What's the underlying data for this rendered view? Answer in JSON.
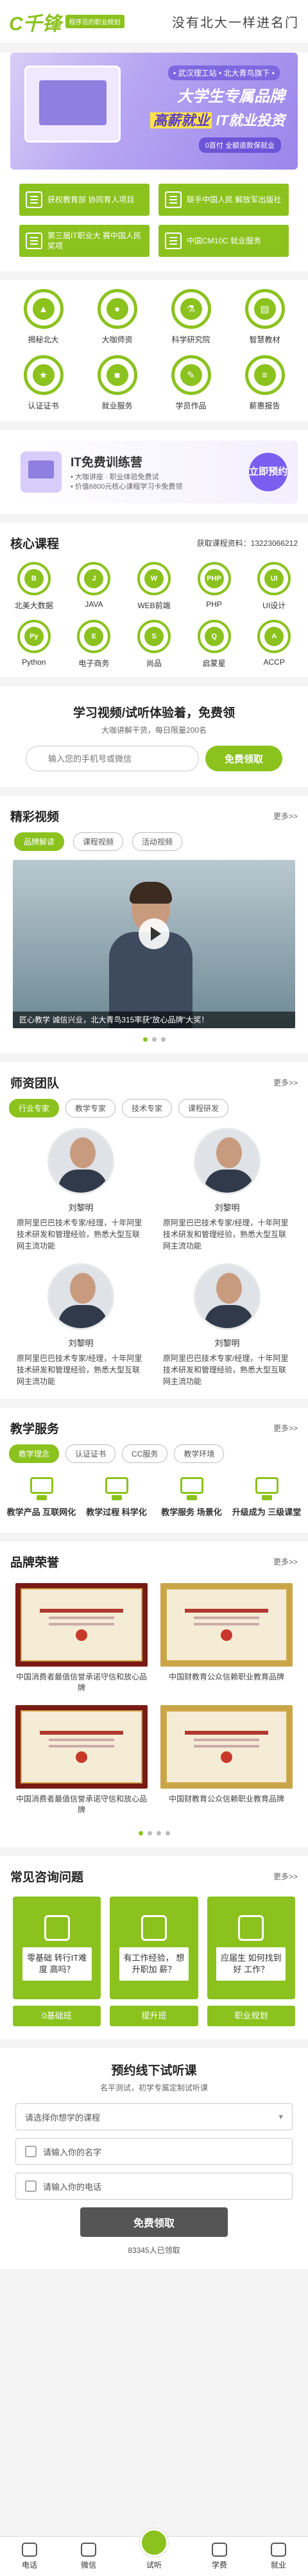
{
  "header": {
    "logo": "C千锋",
    "tag": "程序员的职业规划",
    "slogan": "没有北大一样进名门"
  },
  "banner": {
    "line1": "• 武汉理工站 • 北大青鸟旗下 •",
    "line2": "大学生专属品牌",
    "line3_a": "高薪就业",
    "line3_b": "IT就业投资",
    "cta": "0首付 全额退款保就业"
  },
  "notices": [
    {
      "label": "获权教育部 协同育人项目"
    },
    {
      "label": "联手中国人民 解放军出版社"
    },
    {
      "label": "第三届IT职业大 赛中国人民奖项"
    },
    {
      "label": "中国CM10C 就业服务"
    }
  ],
  "nav_grid": [
    {
      "label": "揭秘北大",
      "icon": "building-icon"
    },
    {
      "label": "大咖师资",
      "icon": "teacher-icon"
    },
    {
      "label": "科学研究院",
      "icon": "flask-icon"
    },
    {
      "label": "智慧教材",
      "icon": "book-icon"
    },
    {
      "label": "认证证书",
      "icon": "certificate-icon"
    },
    {
      "label": "就业服务",
      "icon": "briefcase-icon"
    },
    {
      "label": "学员作品",
      "icon": "palette-icon"
    },
    {
      "label": "薪惠报告",
      "icon": "report-icon"
    }
  ],
  "camp": {
    "title": "IT免费训练营",
    "line1": "• 大咖讲座 · 职业体验免费试",
    "line2": "• 价值6800元核心课程学习卡免费领",
    "cta": "立即预约"
  },
  "core": {
    "title": "核心课程",
    "hotline_label": "获取课程资料：",
    "hotline": "13223066212",
    "items": [
      {
        "label": "北美大数据",
        "glyph": "B"
      },
      {
        "label": "JAVA",
        "glyph": "J"
      },
      {
        "label": "WEB前端",
        "glyph": "W"
      },
      {
        "label": "PHP",
        "glyph": "PHP"
      },
      {
        "label": "UI设计",
        "glyph": "UI"
      },
      {
        "label": "Python",
        "glyph": "Py"
      },
      {
        "label": "电子商务",
        "glyph": "E"
      },
      {
        "label": "尚品",
        "glyph": "S"
      },
      {
        "label": "启蒙星",
        "glyph": "Q"
      },
      {
        "label": "ACCP",
        "glyph": "A"
      }
    ]
  },
  "trial": {
    "title": "学习视频/试听体验着，免费领",
    "sub": "大咖讲解干货，每日限量200名",
    "placeholder": "输入您的手机号或微信",
    "cta": "免费领取"
  },
  "video": {
    "title": "精彩视频",
    "more": "更多>>",
    "tabs": [
      "品牌解读",
      "课程视频",
      "活动视频"
    ],
    "caption": "匠心教学 诚信兴业，北大青鸟315率获“放心品牌”大奖！"
  },
  "teachers": {
    "title": "师资团队",
    "more": "更多>>",
    "tabs": [
      "行业专家",
      "教学专家",
      "技术专家",
      "课程研发"
    ],
    "list": [
      {
        "name": "刘黎明",
        "desc": "原阿里巴巴技术专家/经理，十年阿里技术研发和管理经验，熟悉大型互联网主流功能"
      },
      {
        "name": "刘黎明",
        "desc": "原阿里巴巴技术专家/经理，十年阿里技术研发和管理经验，熟悉大型互联网主流功能"
      },
      {
        "name": "刘黎明",
        "desc": "原阿里巴巴技术专家/经理，十年阿里技术研发和管理经验，熟悉大型互联网主流功能"
      },
      {
        "name": "刘黎明",
        "desc": "原阿里巴巴技术专家/经理，十年阿里技术研发和管理经验，熟悉大型互联网主流功能"
      }
    ]
  },
  "services": {
    "title": "教学服务",
    "more": "更多>>",
    "tabs": [
      "教学理念",
      "认证证书",
      "CC服务",
      "教学环境"
    ],
    "items": [
      {
        "label": "教学产品 互联网化"
      },
      {
        "label": "教学过程 科学化"
      },
      {
        "label": "教学服务 场景化"
      },
      {
        "label": "升级成为 三级课堂"
      }
    ]
  },
  "honors": {
    "title": "品牌荣誉",
    "more": "更多>>",
    "items": [
      {
        "caption": "中国消费者最值信誉承诺守信和放心品牌"
      },
      {
        "caption": "中国财教育公众信赖职业教育品牌"
      },
      {
        "caption": "中国消费者最值信誉承诺守信和放心品牌"
      },
      {
        "caption": "中国财教育公众信赖职业教育品牌"
      }
    ]
  },
  "faq": {
    "title": "常见咨询问题",
    "more": "更多>>",
    "items": [
      {
        "question": "零基础 转行IT难度 高吗？",
        "label": "0基础班"
      },
      {
        "question": "有工作经验， 想升职加 薪？",
        "label": "提升班"
      },
      {
        "question": "应届生 如何找到好 工作？",
        "label": "职业规划"
      }
    ]
  },
  "form": {
    "title": "预约线下试听课",
    "sub": "名平测试，初学专属定制试听课",
    "course_placeholder": "请选择你想学的课程",
    "name_placeholder": "请输入你的名字",
    "phone_placeholder": "请输入你的电话",
    "submit": "免费领取",
    "count": "83345人已领取"
  },
  "bottombar": {
    "items": [
      {
        "label": "电话",
        "icon": "phone-icon"
      },
      {
        "label": "微信",
        "icon": "wechat-icon"
      },
      {
        "label": "试听",
        "icon": "headphones-icon"
      },
      {
        "label": "学费",
        "icon": "wallet-icon"
      },
      {
        "label": "就业",
        "icon": "briefcase-icon"
      }
    ]
  }
}
